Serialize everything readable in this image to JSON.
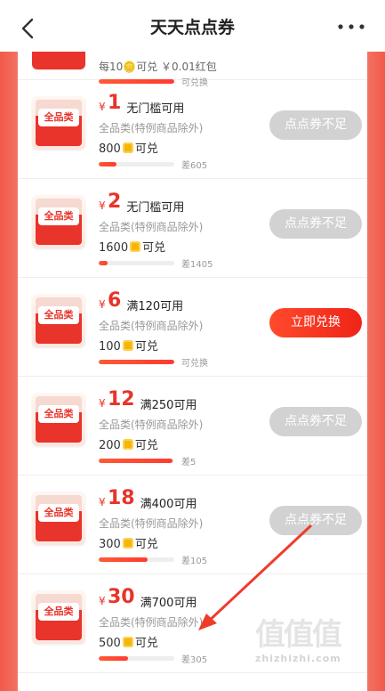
{
  "header": {
    "title": "天天点点券"
  },
  "partial": {
    "text": "每10🪙可兑 ￥0.01红包",
    "status": "可兑换",
    "progress": 1.0
  },
  "cards": [
    {
      "badge": "全品类",
      "currency": "¥",
      "amount": "1",
      "condition": "无门槛可用",
      "scope": "全品类(特例商品除外)",
      "points": "800",
      "points_suffix": "可兑",
      "progress": 0.24,
      "gap": "差605",
      "button": "点点券不足",
      "state": "disabled"
    },
    {
      "badge": "全品类",
      "currency": "¥",
      "amount": "2",
      "condition": "无门槛可用",
      "scope": "全品类(特例商品除外)",
      "points": "1600",
      "points_suffix": "可兑",
      "progress": 0.12,
      "gap": "差1405",
      "button": "点点券不足",
      "state": "disabled"
    },
    {
      "badge": "全品类",
      "currency": "¥",
      "amount": "6",
      "condition": "满120可用",
      "scope": "全品类(特例商品除外)",
      "points": "100",
      "points_suffix": "可兑",
      "progress": 1.0,
      "gap": "可兑换",
      "button": "立即兑换",
      "state": "active"
    },
    {
      "badge": "全品类",
      "currency": "¥",
      "amount": "12",
      "condition": "满250可用",
      "scope": "全品类(特例商品除外)",
      "points": "200",
      "points_suffix": "可兑",
      "progress": 0.98,
      "gap": "差5",
      "button": "点点券不足",
      "state": "disabled"
    },
    {
      "badge": "全品类",
      "currency": "¥",
      "amount": "18",
      "condition": "满400可用",
      "scope": "全品类(特例商品除外)",
      "points": "300",
      "points_suffix": "可兑",
      "progress": 0.65,
      "gap": "差105",
      "button": "点点券不足",
      "state": "disabled"
    },
    {
      "badge": "全品类",
      "currency": "¥",
      "amount": "30",
      "condition": "满700可用",
      "scope": "全品类(特例商品除外)",
      "points": "500",
      "points_suffix": "可兑",
      "progress": 0.39,
      "gap": "差305",
      "button": "",
      "state": "hidden"
    }
  ],
  "watermark": {
    "main": "值值值",
    "site": "zhizhizhi.com"
  },
  "colors": {
    "accent": "#e8342a",
    "disabled": "#d2d2d2",
    "progress": "#ff3b2f"
  }
}
